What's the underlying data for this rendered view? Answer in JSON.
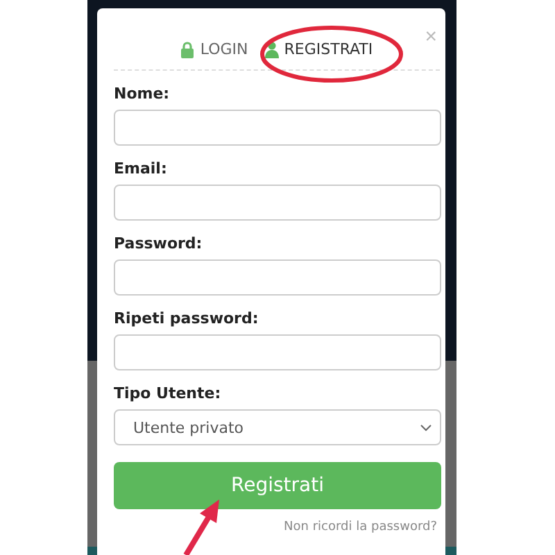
{
  "tabs": [
    {
      "label": "LOGIN",
      "kind": "lock",
      "selected": false
    },
    {
      "label": "REGISTRATI",
      "kind": "user",
      "selected": true
    }
  ],
  "close": "×",
  "fields": [
    {
      "label": "Nome:",
      "kind": "text"
    },
    {
      "label": "Email:",
      "kind": "text"
    },
    {
      "label": "Password:",
      "kind": "text"
    },
    {
      "label": "Ripeti password:",
      "kind": "text"
    },
    {
      "label": "Tipo Utente:",
      "kind": "select",
      "value": "Utente privato"
    }
  ],
  "submit": "Registrati",
  "forgot_link": "Non ricordi la password?"
}
